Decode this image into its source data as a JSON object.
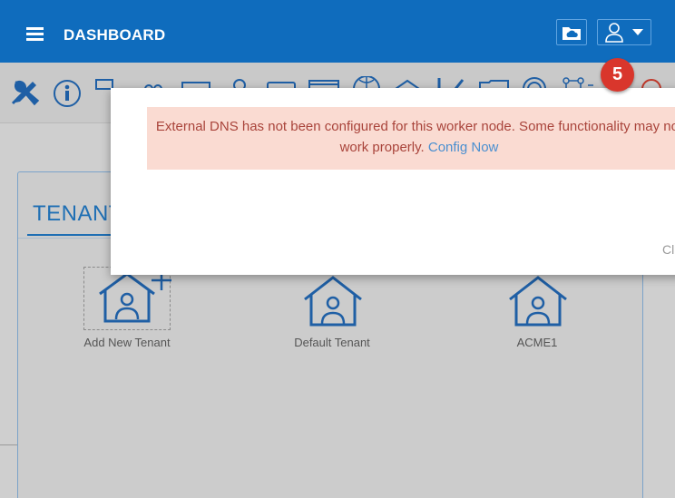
{
  "header": {
    "title": "DASHBOARD",
    "menu_icon": "hamburger-menu-icon",
    "cloud_button_icon": "cloud-folder-icon",
    "user_button_icon": "user-icon",
    "bg_color": "#0f6cbd"
  },
  "toolbar": {
    "icons": [
      "tools-icon",
      "info-icon",
      "print-icon",
      "group-icon",
      "mail-icon",
      "search-icon",
      "list-icon",
      "window-icon",
      "globe-icon",
      "cube-icon",
      "tune-icon",
      "folder-icon",
      "fingerprint-icon",
      "network-icon",
      "alert-icon"
    ],
    "notification_badge": "5",
    "badge_color": "#d9362c"
  },
  "modal": {
    "alert_text": "External DNS has not been configured for this worker node. Some functionality may not work properly.",
    "alert_link": "Config Now",
    "close_label": "Cl"
  },
  "tenants": {
    "header": "TENANT",
    "tiles": [
      {
        "label": "Add New Tenant",
        "icon": "add-tenant-icon"
      },
      {
        "label": "Default Tenant",
        "icon": "tenant-house-icon"
      },
      {
        "label": "ACME1",
        "icon": "tenant-house-icon"
      }
    ]
  }
}
